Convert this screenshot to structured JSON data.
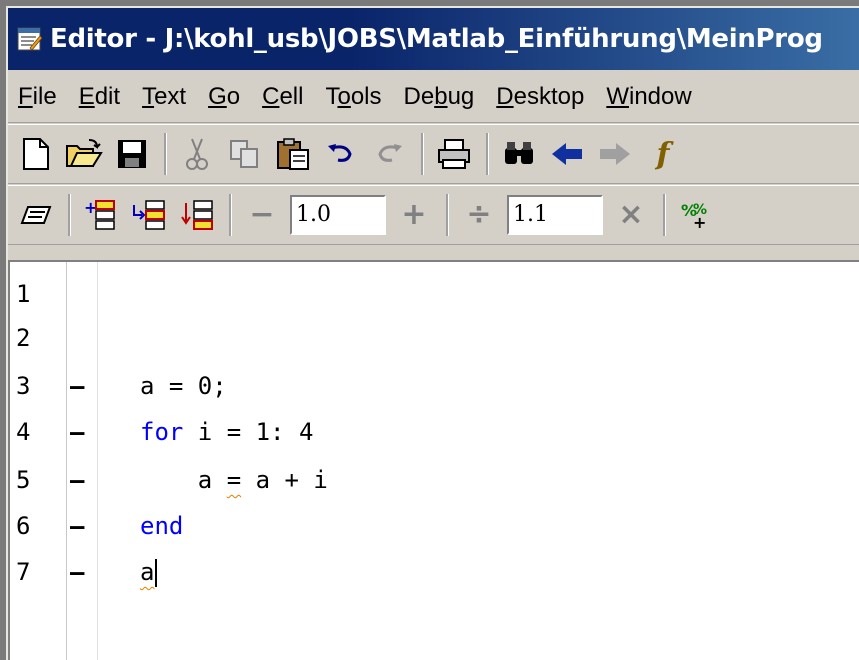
{
  "window": {
    "title": "Editor - J:\\kohl_usb\\JOBS\\Matlab_Einführung\\MeinProg"
  },
  "menu": [
    {
      "label": "File",
      "mnemonic_index": 0
    },
    {
      "label": "Edit",
      "mnemonic_index": 0
    },
    {
      "label": "Text",
      "mnemonic_index": 0
    },
    {
      "label": "Go",
      "mnemonic_index": 0
    },
    {
      "label": "Cell",
      "mnemonic_index": 0
    },
    {
      "label": "Tools",
      "mnemonic_index": 1
    },
    {
      "label": "Debug",
      "mnemonic_index": 2
    },
    {
      "label": "Desktop",
      "mnemonic_index": 0
    },
    {
      "label": "Window",
      "mnemonic_index": 0
    }
  ],
  "toolbar1": {
    "icons": [
      "new-file-icon",
      "open-folder-icon",
      "save-icon",
      "cut-icon",
      "copy-icon",
      "paste-icon",
      "undo-icon",
      "redo-icon",
      "print-icon",
      "find-icon",
      "back-arrow-icon",
      "forward-arrow-icon"
    ]
  },
  "toolbar2": {
    "decrement_value": "1.0",
    "divide_value": "1.1",
    "minus_glyph": "−",
    "plus_glyph": "+",
    "divide_glyph": "÷",
    "times_glyph": "×"
  },
  "editor": {
    "lines": [
      {
        "num": "1",
        "breakpoint": "",
        "code": ""
      },
      {
        "num": "2",
        "breakpoint": "",
        "code": ""
      },
      {
        "num": "3",
        "breakpoint": "—",
        "code": "a = 0;"
      },
      {
        "num": "4",
        "breakpoint": "—",
        "keyword": "for",
        "code": " i = 1: 4"
      },
      {
        "num": "5",
        "breakpoint": "—",
        "code_a": "    a ",
        "code_eq": "=",
        "code_b": " a + i"
      },
      {
        "num": "6",
        "breakpoint": "—",
        "keyword": "end",
        "code": ""
      },
      {
        "num": "7",
        "breakpoint": "—",
        "code_a": "a"
      }
    ]
  },
  "colors": {
    "title_bar": "#0a246a",
    "keyword": "#0000ff",
    "mlint_warning": "#e08000",
    "window_bg": "#d4d0c8"
  }
}
